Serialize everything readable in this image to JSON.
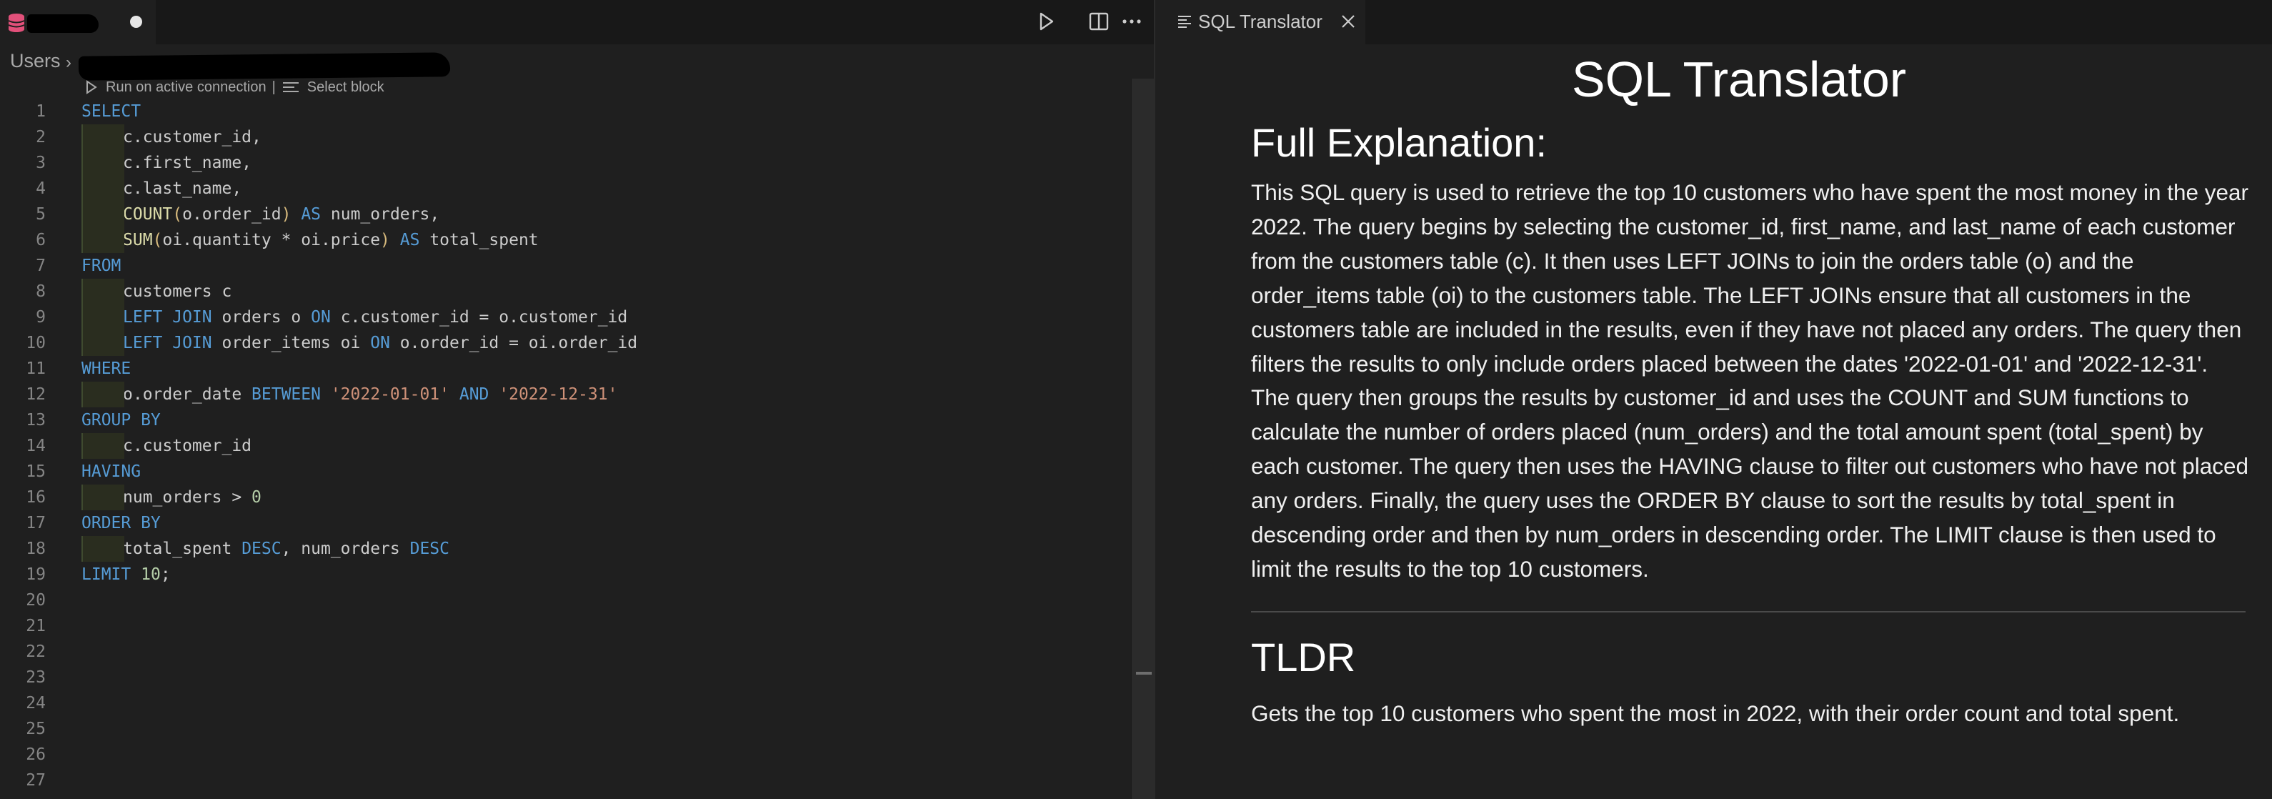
{
  "editor": {
    "breadcrumb_root": "Users",
    "codelens": {
      "run_label": "Run on active connection",
      "separator": "|",
      "select_label": "Select block"
    },
    "line_numbers": [
      "1",
      "2",
      "3",
      "4",
      "5",
      "6",
      "7",
      "8",
      "9",
      "10",
      "11",
      "12",
      "13",
      "14",
      "15",
      "16",
      "17",
      "18",
      "19",
      "20",
      "21",
      "22",
      "23",
      "24",
      "25",
      "26",
      "27"
    ],
    "code": {
      "l1_kw": "SELECT",
      "l2": "c.customer_id,",
      "l3": "c.first_name,",
      "l4": "c.last_name,",
      "l5_fn": "COUNT",
      "l5_open": "(",
      "l5_arg": "o.order_id",
      "l5_close": ")",
      "l5_as": "AS",
      "l5_alias": "num_orders,",
      "l6_fn": "SUM",
      "l6_open": "(",
      "l6_arg": "oi.quantity * oi.price",
      "l6_close": ")",
      "l6_as": "AS",
      "l6_alias": "total_spent",
      "l7_kw": "FROM",
      "l8": "customers c",
      "l9_kw": "LEFT JOIN",
      "l9_tbl": "orders o",
      "l9_on": "ON",
      "l9_cond": "c.customer_id = o.customer_id",
      "l10_kw": "LEFT JOIN",
      "l10_tbl": "order_items oi",
      "l10_on": "ON",
      "l10_cond": "o.order_id = oi.order_id",
      "l11_kw": "WHERE",
      "l12_col": "o.order_date",
      "l12_between": "BETWEEN",
      "l12_from": "'2022-01-01'",
      "l12_and": "AND",
      "l12_to": "'2022-12-31'",
      "l13_kw": "GROUP BY",
      "l14": "c.customer_id",
      "l15_kw": "HAVING",
      "l16_expr": "num_orders >",
      "l16_num": "0",
      "l17_kw": "ORDER BY",
      "l18_a": "total_spent",
      "l18_desc1": "DESC",
      "l18_b": ", num_orders",
      "l18_desc2": "DESC",
      "l19_kw": "LIMIT",
      "l19_num": "10",
      "l19_end": ";"
    }
  },
  "preview": {
    "tab_label": "SQL Translator",
    "title": "SQL Translator",
    "full_heading": "Full Explanation:",
    "full_text": "This SQL query is used to retrieve the top 10 customers who have spent the most money in the year 2022. The query begins by selecting the customer_id, first_name, and last_name of each customer from the customers table (c). It then uses LEFT JOINs to join the orders table (o) and the order_items table (oi) to the customers table. The LEFT JOINs ensure that all customers in the customers table are included in the results, even if they have not placed any orders. The query then filters the results to only include orders placed between the dates '2022-01-01' and '2022-12-31'. The query then groups the results by customer_id and uses the COUNT and SUM functions to calculate the number of orders placed (num_orders) and the total amount spent (total_spent) by each customer. The query then uses the HAVING clause to filter out customers who have not placed any orders. Finally, the query uses the ORDER BY clause to sort the results by total_spent in descending order and then by num_orders in descending order. The LIMIT clause is then used to limit the results to the top 10 customers.",
    "tldr_heading": "TLDR",
    "tldr_text": "Gets the top 10 customers who spent the most in 2022, with their order count and total spent."
  },
  "colors": {
    "keyword": "#569cd6",
    "function": "#dcdcaa",
    "string": "#ce9178",
    "number": "#b5cea8",
    "bracket": "#d7ba7d",
    "db_icon": "#e2507a"
  },
  "icons": [
    "database-icon",
    "dirty-dot-icon",
    "run-icon",
    "split-editor-icon",
    "more-icon",
    "preview-icon",
    "close-icon",
    "lines-icon"
  ]
}
